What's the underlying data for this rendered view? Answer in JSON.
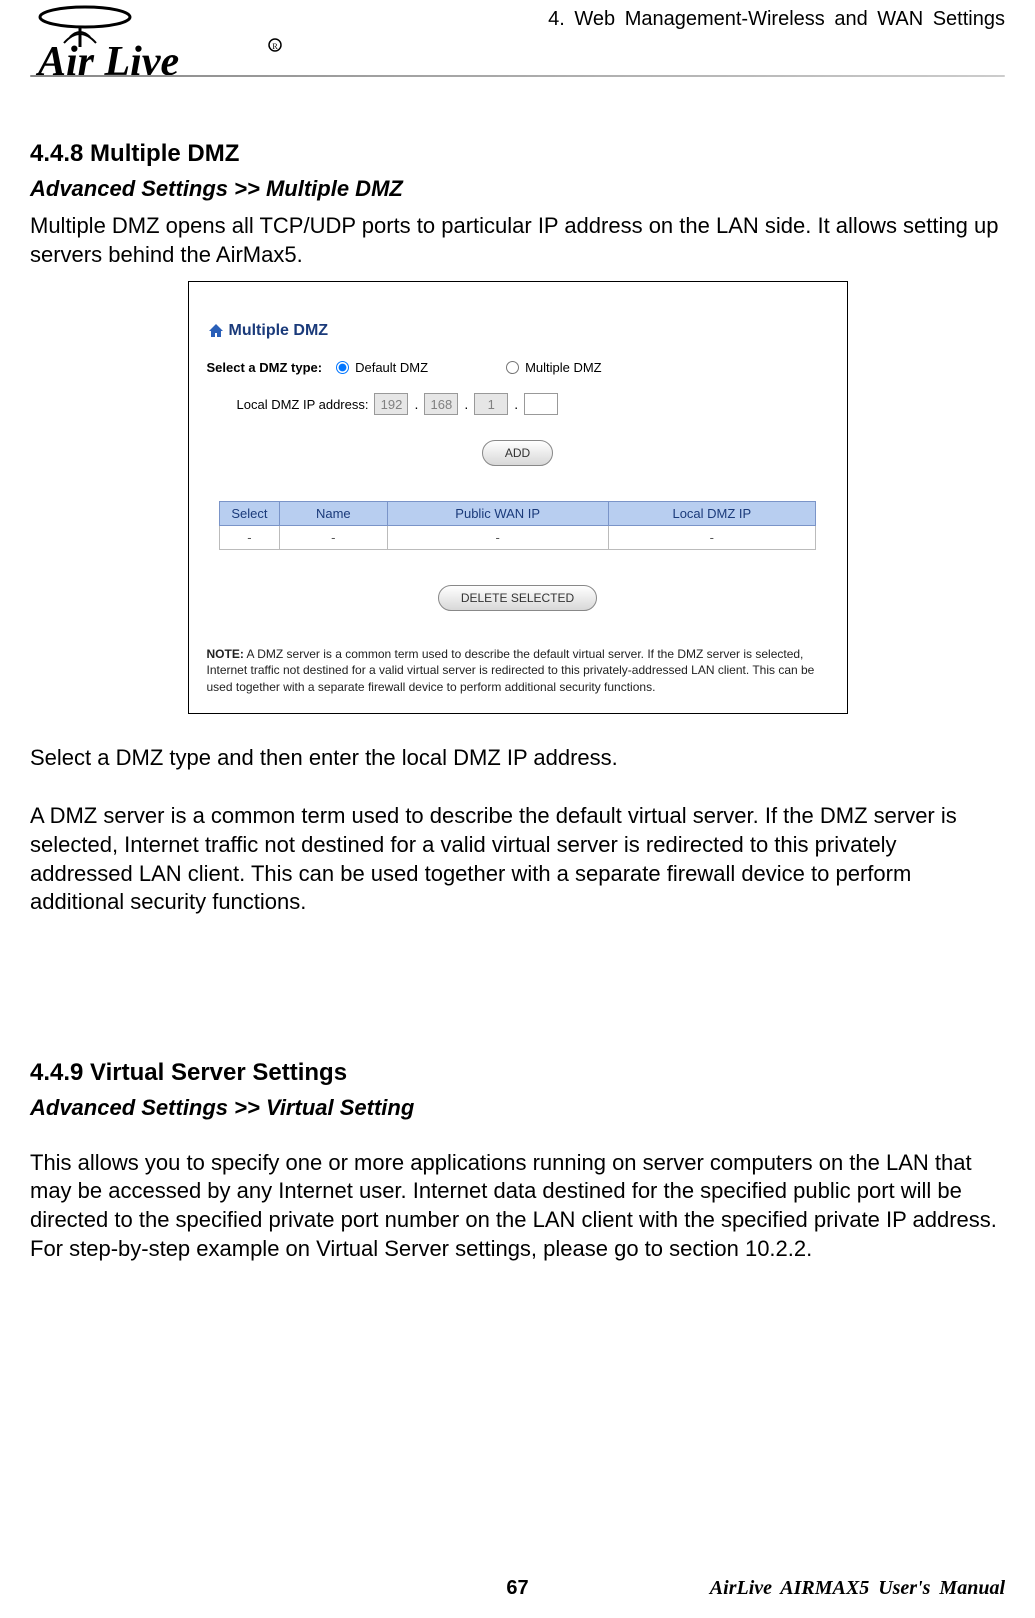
{
  "header": {
    "brand_name": "Air Live",
    "chapter_title": "4. Web Management-Wireless and WAN Settings"
  },
  "section1": {
    "heading": "4.4.8 Multiple DMZ",
    "breadcrumb": "Advanced Settings >> Multiple DMZ",
    "intro": "Multiple DMZ opens all TCP/UDP ports to particular IP address on the LAN side.    It allows setting up servers behind the AirMax5.",
    "followup1": "Select a DMZ type and then enter the local DMZ IP address.",
    "followup2": "A DMZ server is a common term used to describe the default virtual server. If the DMZ server is selected, Internet traffic not destined for a valid virtual server is redirected to this privately addressed LAN client. This can be used together with a separate firewall device to perform additional security functions."
  },
  "panel": {
    "title": "Multiple DMZ",
    "select_label": "Select a DMZ type:",
    "radio_default": "Default DMZ",
    "radio_multiple": "Multiple DMZ",
    "ip_label": "Local DMZ IP address:",
    "octet1": "192",
    "octet2": "168",
    "octet3": "1",
    "octet4": "",
    "add_btn": "ADD",
    "table": {
      "headers": [
        "Select",
        "Name",
        "Public WAN IP",
        "Local DMZ IP"
      ],
      "row": [
        "-",
        "-",
        "-",
        "-"
      ]
    },
    "delete_btn": "DELETE SELECTED",
    "note_label": "NOTE:",
    "note_text": " A DMZ server is a common term used to describe the default virtual server. If the DMZ server is selected, Internet traffic not destined for a valid virtual server is redirected to this privately-addressed LAN client. This can be used together with a separate firewall device to perform additional security functions."
  },
  "section2": {
    "heading": "4.4.9 Virtual Server Settings",
    "breadcrumb": "Advanced Settings >> Virtual Setting",
    "body": "This allows you to specify one or more applications running on server computers on the LAN that may be accessed by any Internet user. Internet data destined for the specified public port will be directed to the specified private port number on the LAN client with the specified private IP address.   For step-by-step example on Virtual Server settings, please go to section 10.2.2."
  },
  "footer": {
    "page": "67",
    "manual": "AirLive AIRMAX5 User's Manual"
  }
}
